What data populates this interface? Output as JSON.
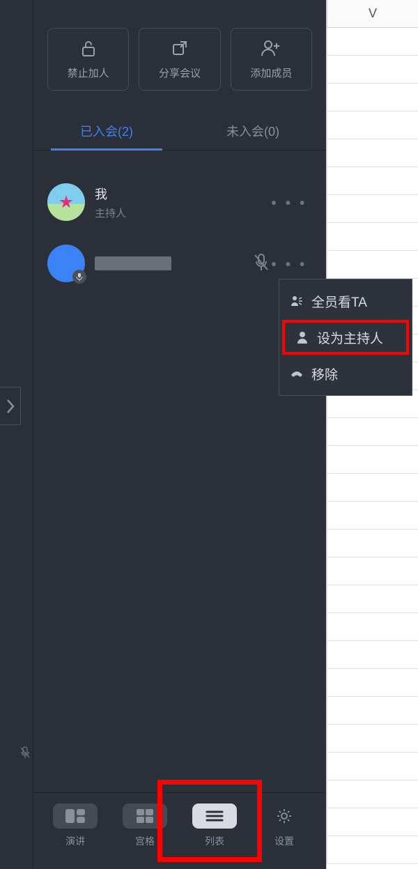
{
  "topActions": {
    "lock": "禁止加人",
    "share": "分享会议",
    "add": "添加成员"
  },
  "tabs": {
    "joined": "已入会(2)",
    "notJoined": "未入会(0)"
  },
  "members": [
    {
      "name": "我",
      "role": "主持人"
    },
    {
      "name": "",
      "role": ""
    }
  ],
  "contextMenu": {
    "spotlight": "全员看TA",
    "makeHost": "设为主持人",
    "remove": "移除"
  },
  "bottomBar": {
    "speaker": "演讲",
    "grid": "宫格",
    "list": "列表",
    "settings": "设置"
  },
  "sheet": {
    "columnLetter": "V"
  }
}
